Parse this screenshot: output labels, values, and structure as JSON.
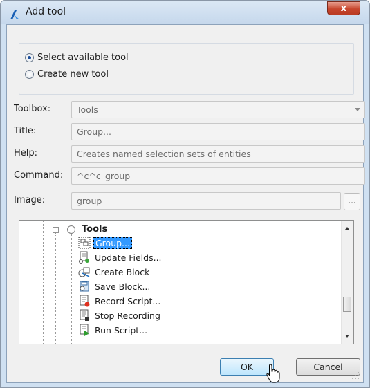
{
  "window": {
    "title": "Add tool",
    "close_label": "x"
  },
  "mode": {
    "options": [
      {
        "label": "Select available tool",
        "selected": true
      },
      {
        "label": "Create new tool",
        "selected": false
      }
    ]
  },
  "form": {
    "toolbox": {
      "label": "Toolbox:",
      "value": "Tools"
    },
    "title": {
      "label": "Title:",
      "value": "Group..."
    },
    "help": {
      "label": "Help:",
      "value": "Creates named selection sets of entities"
    },
    "command": {
      "label": "Command:",
      "value": "^c^c_group"
    },
    "image": {
      "label": "Image:",
      "value": "group",
      "browse_label": "..."
    }
  },
  "tree": {
    "root_label": "Tools",
    "items": [
      {
        "label": "Group...",
        "icon": "group-icon",
        "selected": true
      },
      {
        "label": "Update Fields...",
        "icon": "update-fields-icon",
        "selected": false
      },
      {
        "label": "Create Block",
        "icon": "create-block-icon",
        "selected": false
      },
      {
        "label": "Save Block...",
        "icon": "save-block-icon",
        "selected": false
      },
      {
        "label": "Record Script...",
        "icon": "record-script-icon",
        "selected": false
      },
      {
        "label": "Stop Recording",
        "icon": "stop-recording-icon",
        "selected": false
      },
      {
        "label": "Run Script...",
        "icon": "run-script-icon",
        "selected": false
      }
    ]
  },
  "buttons": {
    "ok": "OK",
    "cancel": "Cancel"
  },
  "colors": {
    "selection": "#3399ff",
    "title_bar": "#c6d8ec",
    "close_button": "#c7462d"
  }
}
